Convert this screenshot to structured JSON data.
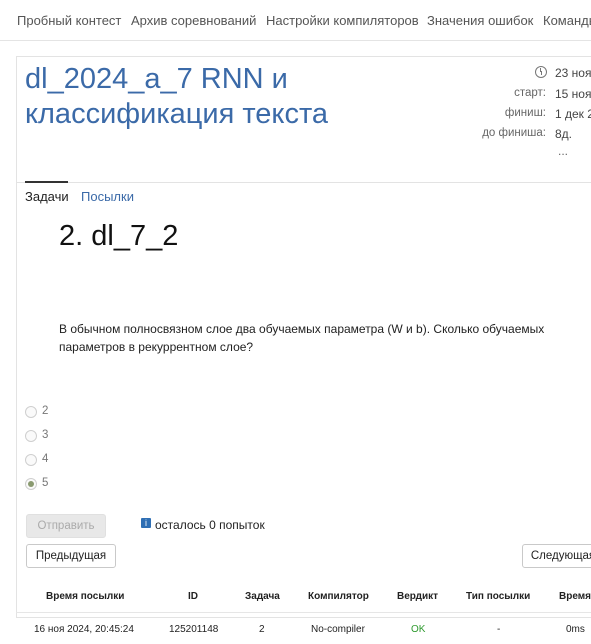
{
  "nav": {
    "items": [
      "Пробный контест",
      "Архив соревнований",
      "Настройки компиляторов",
      "Значения ошибок",
      "Команды"
    ]
  },
  "contest": {
    "title_line1": "dl_2024_a_7 RNN и",
    "title_line2": "классификация текста",
    "date": "23 ноя",
    "start_label": "старт:",
    "start_value": "15 ноя",
    "finish_label": "финиш:",
    "finish_value": "1 дек 2",
    "remaining_label": "до финиша:",
    "remaining_value": "8д.",
    "ellipsis": "..."
  },
  "tabs": {
    "problems": "Задачи",
    "submissions": "Посылки"
  },
  "problem": {
    "title": "2. dl_7_2",
    "statement_line1": "В обычном полносвязном слое два обучаемых параметра (W и b). Сколько обучаемых",
    "statement_line2": "параметров в рекуррентном слое?",
    "options": [
      "2",
      "3",
      "4",
      "5"
    ],
    "selected": "5"
  },
  "actions": {
    "submit": "Отправить",
    "attempts_text": "осталось 0 попыток",
    "prev": "Предыдущая",
    "next": "Следующая"
  },
  "table": {
    "headers": [
      "Время посылки",
      "ID",
      "Задача",
      "Компилятор",
      "Вердикт",
      "Тип посылки",
      "Время"
    ],
    "rows": [
      [
        "16 ноя 2024, 20:45:24",
        "125201148",
        "2",
        "No-compiler",
        "OK",
        "-",
        "0ms"
      ]
    ]
  },
  "colors": {
    "link": "#3b6aa8",
    "ok": "#2e9a2e",
    "info": "#2f6fb4"
  }
}
